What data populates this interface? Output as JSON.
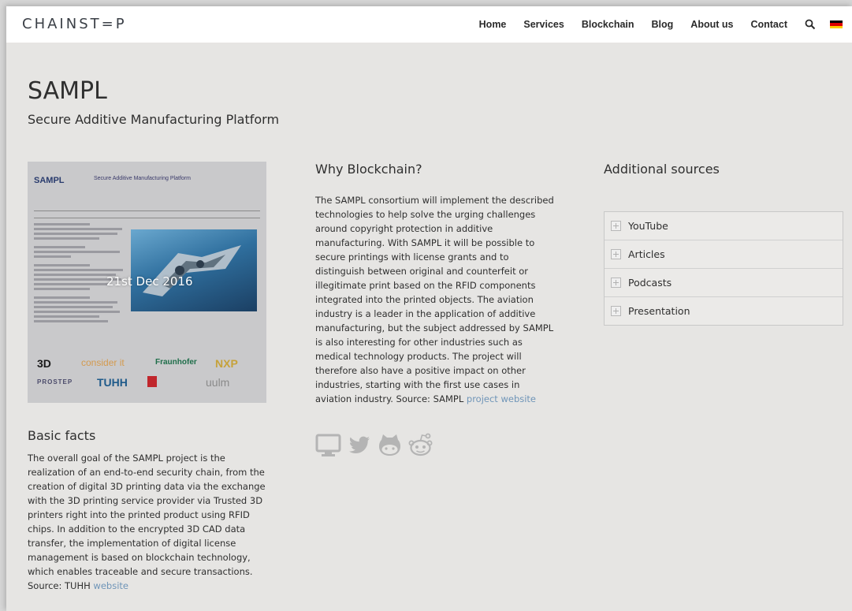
{
  "header": {
    "logo": "CHAINST=P",
    "nav": [
      "Home",
      "Services",
      "Blockchain",
      "Blog",
      "About us",
      "Contact"
    ],
    "flag_colors": [
      "#000000",
      "#dd0000",
      "#ffce00"
    ]
  },
  "main": {
    "title": "SAMPL",
    "subtitle": "Secure Additive Manufacturing Platform"
  },
  "poster": {
    "doc_logo": "SAMPL",
    "doc_title": "Secure Additive Manufacturing Platform",
    "date": "21st Dec 2016",
    "partners": [
      "3D",
      "consider it",
      "Fraunhofer",
      "NXP",
      "PROSTEP",
      "TUHH",
      "uulm"
    ]
  },
  "basic_facts": {
    "heading": "Basic facts",
    "text": "The overall goal of the SAMPL project is the realization of an end-to-end security chain, from the creation of digital 3D printing data via the exchange with the 3D printing service provider via Trusted 3D printers right into the printed product using RFID chips. In addition to the encrypted 3D CAD data transfer, the implementation of digital license management is based on blockchain technology, which enables traceable and secure transactions. Source: TUHH",
    "link": "website"
  },
  "why_blockchain": {
    "heading": "Why Blockchain?",
    "text": "The SAMPL consortium will implement the described technologies to help solve the urging challenges around copyright protection in additive manufacturing. With SAMPL it will be possible to secure printings with license grants and to distinguish between original and counterfeit or illegitimate print based on the RFID components integrated into the printed objects. The aviation industry is a leader in the application of additive manufacturing, but the subject addressed by SAMPL is also interesting for other industries such as medical technology products. The project will therefore also have a positive impact on other industries, starting with the first use cases in aviation industry. Source: SAMPL",
    "link": "project website"
  },
  "sources": {
    "heading": "Additional sources",
    "items": [
      "YouTube",
      "Articles",
      "Podcasts",
      "Presentation"
    ]
  },
  "colors": {
    "link": "#6f95b8",
    "share_icons": "#b4b4b4"
  }
}
